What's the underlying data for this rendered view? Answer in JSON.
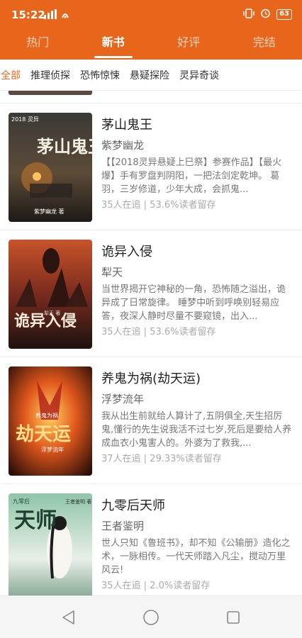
{
  "status": {
    "time": "15:22",
    "signal": "ᵀᵀᵀll ⌕",
    "battery": "63"
  },
  "tabs": [
    {
      "label": "热门"
    },
    {
      "label": "新书"
    },
    {
      "label": "好评"
    },
    {
      "label": "完结"
    }
  ],
  "active_tab": "新书",
  "subtabs": [
    {
      "label": "全部"
    },
    {
      "label": "推理侦探"
    },
    {
      "label": "恐怖惊悚"
    },
    {
      "label": "悬疑探险"
    },
    {
      "label": "灵异奇谈"
    }
  ],
  "active_subtab": "全部",
  "books": [
    {
      "title": "茅山鬼王",
      "author": "紫梦幽龙",
      "desc": "【【2018灵异悬疑上巳祭】参赛作品】【最火爆】手有罗盘判阴阳，一把法剑定乾坤。 葛羽，三岁修道，少年大成，会抓鬼...",
      "stats": "35人在追 |  53.6%读者留存",
      "cover_title": "茅山鬼王",
      "cover_author": "紫梦幽龙 著",
      "cover_badge": "2018 灵异"
    },
    {
      "title": "诡异入侵",
      "author": "犁天",
      "desc": "当世界揭开它神秘的一角，恐怖随之溢出，诡异成了日常旋律。 睡梦中听到呼唤别轻易应答，夜深人静时尽量不要窥镜，出入...",
      "stats": "35人在追 |  53.6%读者留存",
      "cover_title": "诡异入侵",
      "cover_author": "犁天 著",
      "cover_badge": ""
    },
    {
      "title": "养鬼为祸(劫天运)",
      "author": "浮梦流年",
      "desc": "我从出生前就给人算计了,五阴俱全,天生招厉鬼,懂行的先生说我活不过七岁,死后是要给人养成血衣小鬼害人的。外婆为了救我,...",
      "stats": "37人在追 |  29.33%读者留存",
      "cover_title": "劫天运",
      "cover_author": "浮梦流年",
      "cover_badge": "养鬼为祸"
    },
    {
      "title": "九零后天师",
      "author": "王者鉴明",
      "desc": "世人只知《鲁班书》，却不知《公输册》造化之术，一脉相传。一代天师踏入凡尘，搅动万里风云!",
      "stats": "35人在追 |  2.0%读者留存",
      "cover_title": "天师",
      "cover_author": "王者鉴明 著",
      "cover_badge": "九零后"
    }
  ],
  "colors": {
    "accent": "#e8661b",
    "text_primary": "#222222",
    "text_secondary": "#666666",
    "text_muted": "#aaaaaa"
  },
  "icons": {
    "nav_back": "triangle-back-icon",
    "nav_home": "circle-home-icon",
    "nav_recent": "square-recent-icon"
  }
}
